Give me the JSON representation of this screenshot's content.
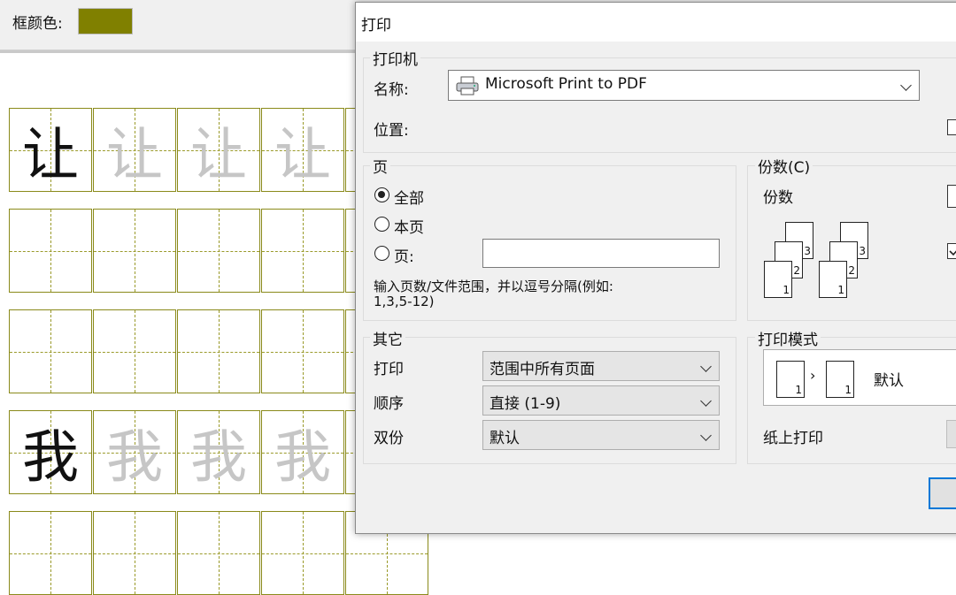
{
  "app": {
    "frame_color_label": "框颜色:",
    "frame_color": "#808000",
    "grid_line_color": "#8a8a1a",
    "practice_rows": [
      {
        "char": "让"
      },
      {
        "char": ""
      },
      {
        "char": ""
      },
      {
        "char": "我"
      },
      {
        "char": ""
      }
    ]
  },
  "dialog": {
    "title": "打印",
    "printer": {
      "legend": "打印机",
      "name_label": "名称:",
      "name_value": "Microsoft Print to PDF",
      "printer_icon": "printer-icon",
      "location_label": "位置:"
    },
    "pages": {
      "legend": "页",
      "all_label": "全部",
      "current_label": "本页",
      "pages_label": "页:",
      "pages_value": "",
      "hint_line1": "输入页数/文件范围，并以逗号分隔(例如:",
      "hint_line2": "1,3,5-12)",
      "selected": "all"
    },
    "copies": {
      "legend": "份数(C)",
      "copies_label": "份数",
      "collate_icon": "collate-pages-icon"
    },
    "other": {
      "legend": "其它",
      "print_label": "打印",
      "print_value": "范围中所有页面",
      "order_label": "顺序",
      "order_value": "直接 (1-9)",
      "duplex_label": "双份",
      "duplex_value": "默认"
    },
    "print_mode": {
      "legend": "打印模式",
      "mode_value": "默认",
      "paper_label": "纸上打印"
    }
  }
}
